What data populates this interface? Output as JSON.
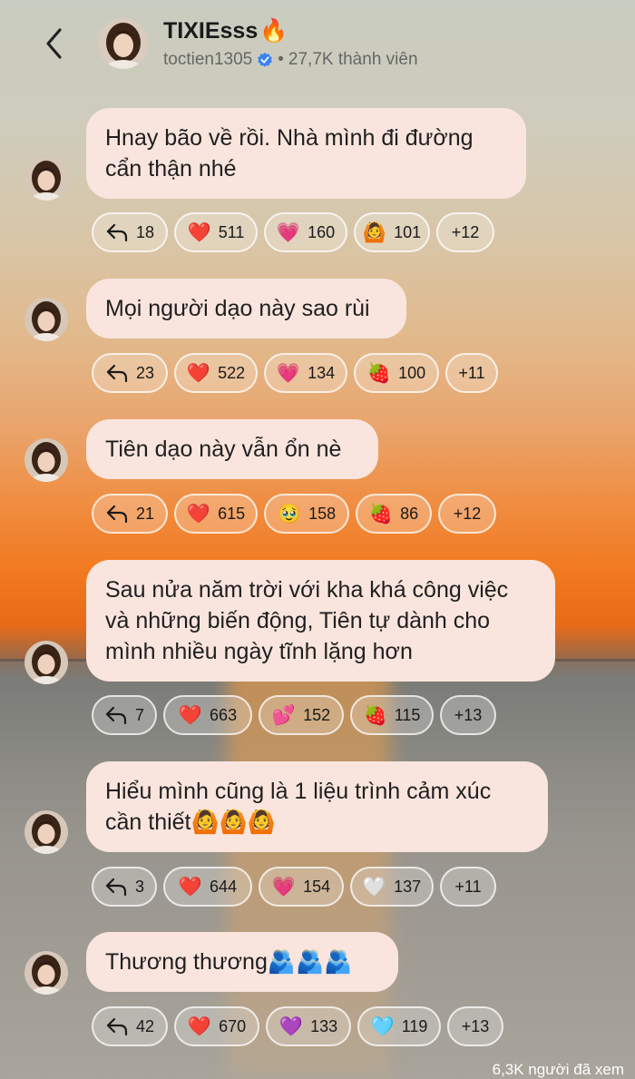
{
  "header": {
    "title": "TIXIEsss",
    "title_emoji": "🔥",
    "handle": "toctien1305",
    "members": "27,7K thành viên"
  },
  "messages": [
    {
      "text": "Hnay bão về rồi. Nhà mình đi đường cẩn thận nhé",
      "reactions": [
        {
          "icon": "reply-arrow-icon",
          "glyph": "",
          "count": "18"
        },
        {
          "icon": "red-heart-icon",
          "glyph": "❤️",
          "count": "511"
        },
        {
          "icon": "pink-heart-icon",
          "glyph": "💗",
          "count": "160"
        },
        {
          "icon": "person-gesturing-ok-icon",
          "glyph": "🙆",
          "count": "101"
        },
        {
          "icon": "",
          "glyph": "",
          "count": "+12"
        }
      ]
    },
    {
      "text": "Mọi người dạo này sao rùi",
      "reactions": [
        {
          "icon": "reply-arrow-icon",
          "glyph": "",
          "count": "23"
        },
        {
          "icon": "red-heart-icon",
          "glyph": "❤️",
          "count": "522"
        },
        {
          "icon": "pink-heart-icon",
          "glyph": "💗",
          "count": "134"
        },
        {
          "icon": "strawberry-icon",
          "glyph": "🍓",
          "count": "100"
        },
        {
          "icon": "",
          "glyph": "",
          "count": "+11"
        }
      ]
    },
    {
      "text": "Tiên dạo này vẫn ổn nè",
      "reactions": [
        {
          "icon": "reply-arrow-icon",
          "glyph": "",
          "count": "21"
        },
        {
          "icon": "red-heart-icon",
          "glyph": "❤️",
          "count": "615"
        },
        {
          "icon": "pleading-face-icon",
          "glyph": "🥹",
          "count": "158"
        },
        {
          "icon": "strawberry-icon",
          "glyph": "🍓",
          "count": "86"
        },
        {
          "icon": "",
          "glyph": "",
          "count": "+12"
        }
      ]
    },
    {
      "text": "Sau nửa năm trời với kha khá công việc và những biến động, Tiên tự dành cho mình nhiều ngày tĩnh lặng hơn",
      "reactions": [
        {
          "icon": "reply-arrow-icon",
          "glyph": "",
          "count": "7"
        },
        {
          "icon": "red-heart-icon",
          "glyph": "❤️",
          "count": "663"
        },
        {
          "icon": "two-hearts-icon",
          "glyph": "💕",
          "count": "152"
        },
        {
          "icon": "strawberry-icon",
          "glyph": "🍓",
          "count": "115"
        },
        {
          "icon": "",
          "glyph": "",
          "count": "+13"
        }
      ]
    },
    {
      "text": "Hiểu mình cũng là 1 liệu trình cảm xúc cần thiết🙆🙆🙆",
      "reactions": [
        {
          "icon": "reply-arrow-icon",
          "glyph": "",
          "count": "3"
        },
        {
          "icon": "red-heart-icon",
          "glyph": "❤️",
          "count": "644"
        },
        {
          "icon": "pink-heart-icon",
          "glyph": "💗",
          "count": "154"
        },
        {
          "icon": "white-heart-icon",
          "glyph": "🤍",
          "count": "137"
        },
        {
          "icon": "",
          "glyph": "",
          "count": "+11"
        }
      ]
    },
    {
      "text": "Thương thương🫂🫂🫂",
      "reactions": [
        {
          "icon": "reply-arrow-icon",
          "glyph": "",
          "count": "42"
        },
        {
          "icon": "red-heart-icon",
          "glyph": "❤️",
          "count": "670"
        },
        {
          "icon": "purple-heart-icon",
          "glyph": "💜",
          "count": "133"
        },
        {
          "icon": "light-blue-heart-icon",
          "glyph": "🩵",
          "count": "119"
        },
        {
          "icon": "",
          "glyph": "",
          "count": "+13"
        }
      ]
    }
  ],
  "footer": {
    "views": "6,3K người đã xem"
  }
}
